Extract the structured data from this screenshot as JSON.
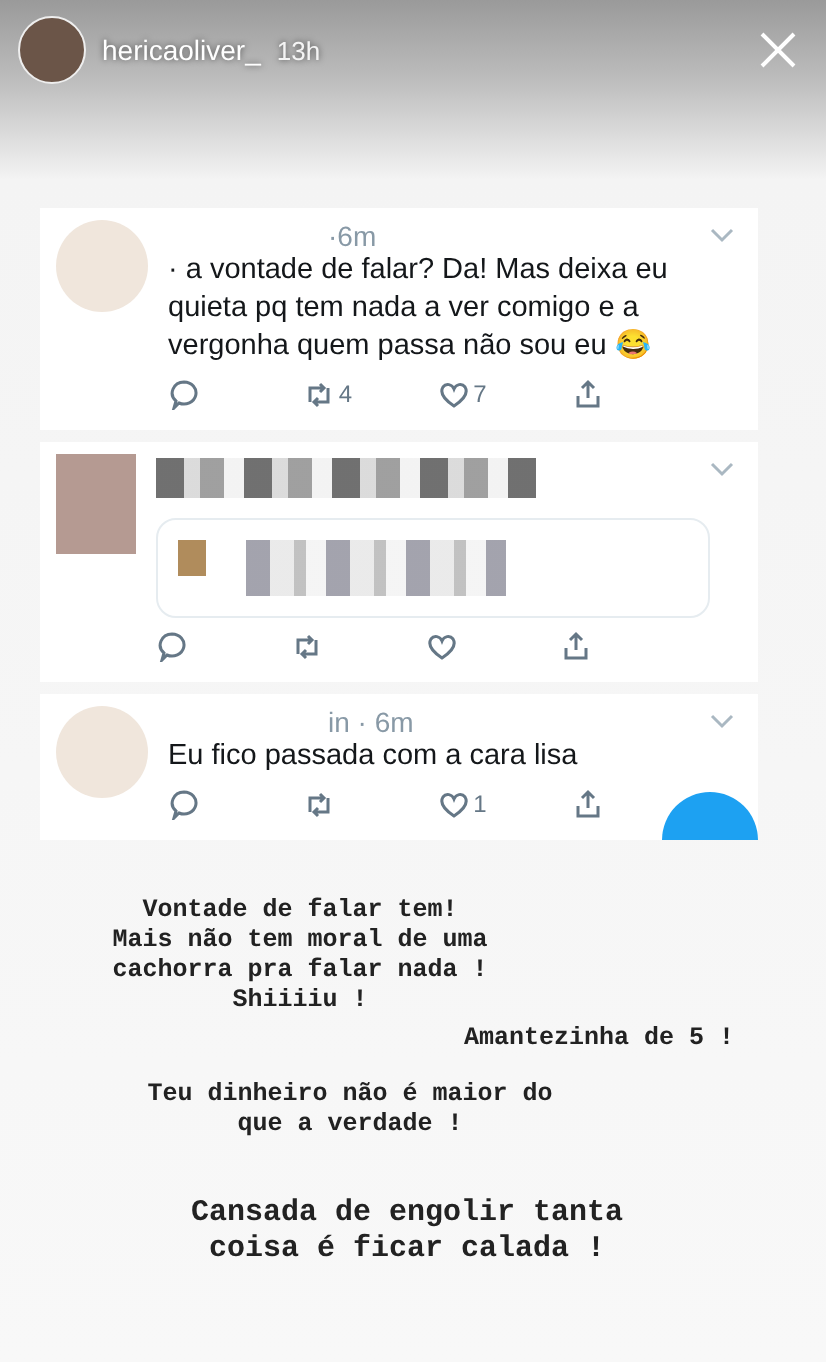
{
  "story_header": {
    "username": "hericaoliver_",
    "time": "13h"
  },
  "tweets": [
    {
      "kind": "text",
      "meta": "·6m",
      "text": "· a vontade de falar? Da! Mas deixa eu quieta pq tem nada a ver comigo e a vergonha quem passa não sou eu 😂",
      "retweets": "4",
      "likes": "7"
    },
    {
      "kind": "blurred"
    },
    {
      "kind": "text",
      "meta": "in · 6m",
      "text": "Eu fico passada com a cara lisa",
      "likes": "1",
      "compose_button": true
    }
  ],
  "captions": [
    {
      "kind": "center",
      "lines": [
        "Vontade de falar tem!",
        "Mais não tem moral de uma",
        "cachorra pra falar nada !",
        "Shiiiiu !"
      ]
    },
    {
      "kind": "right",
      "lines": [
        "Amantezinha de 5 !"
      ]
    },
    {
      "kind": "center",
      "lines": [
        "Teu dinheiro não é maior do",
        "que a verdade !"
      ]
    },
    {
      "kind": "large",
      "lines": [
        "Cansada de engolir tanta",
        "coisa é ficar calada !"
      ]
    }
  ]
}
